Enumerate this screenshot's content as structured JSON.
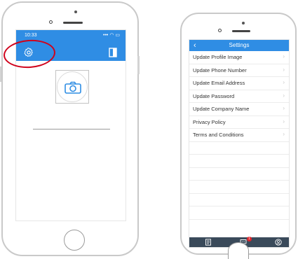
{
  "left_phone": {
    "status_time": "10:33",
    "status_icons": "••• ◠ ▭",
    "app_icons": [
      "gear-icon",
      "bookmark-icon",
      "camera-icon"
    ],
    "annotation_color": "#d0021b"
  },
  "right_phone": {
    "header": {
      "back_icon": "‹",
      "title": "Settings"
    },
    "menu_items": [
      {
        "label": "Update Profile Image"
      },
      {
        "label": "Update Phone Number"
      },
      {
        "label": "Update Email Address"
      },
      {
        "label": "Update Password"
      },
      {
        "label": "Update Company Name"
      },
      {
        "label": "Privacy Policy"
      },
      {
        "label": "Terms and Conditions"
      }
    ],
    "chevron": "›",
    "tabbar": {
      "icons": [
        "document-icon",
        "chat-icon",
        "profile-icon"
      ],
      "badge_count": "1"
    }
  },
  "colors": {
    "accent": "#2f8de4",
    "tabbar": "#3a4a5a",
    "badge": "#e0262d"
  }
}
